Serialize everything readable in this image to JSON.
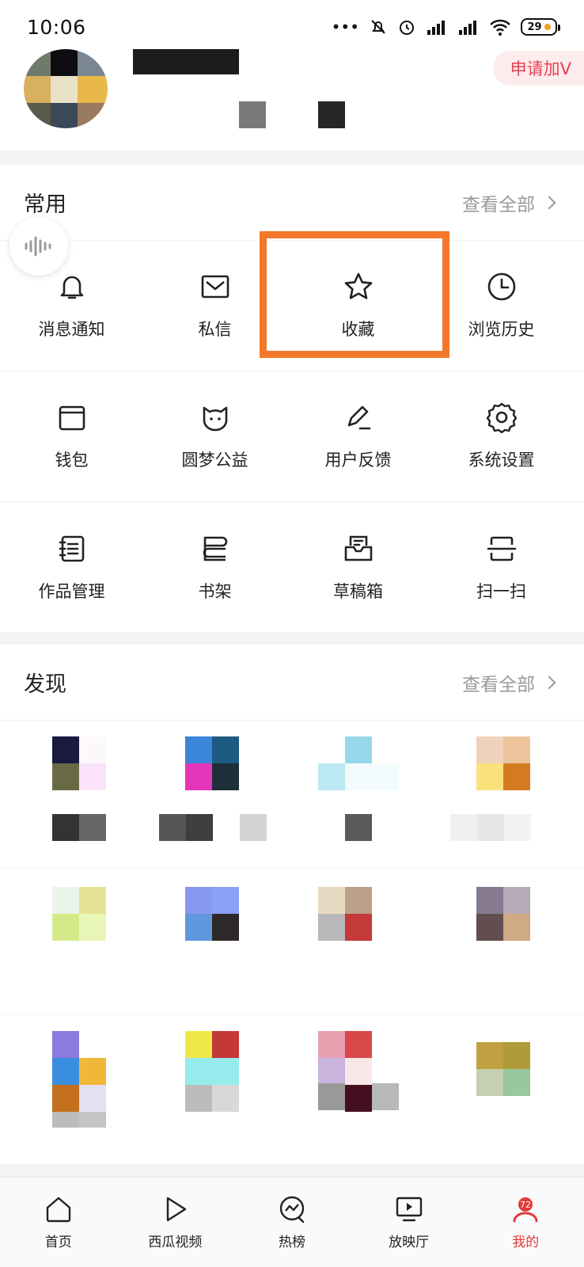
{
  "status_bar": {
    "time": "10:06",
    "battery": "29"
  },
  "profile": {
    "apply_v_label": "申请加V"
  },
  "common": {
    "title": "常用",
    "see_all": "查看全部",
    "items": [
      {
        "label": "消息通知",
        "icon": "bell-icon"
      },
      {
        "label": "私信",
        "icon": "mail-icon"
      },
      {
        "label": "收藏",
        "icon": "star-icon"
      },
      {
        "label": "浏览历史",
        "icon": "clock-icon"
      },
      {
        "label": "钱包",
        "icon": "wallet-icon"
      },
      {
        "label": "圆梦公益",
        "icon": "cat-face-icon"
      },
      {
        "label": "用户反馈",
        "icon": "pen-icon"
      },
      {
        "label": "系统设置",
        "icon": "gear-icon"
      },
      {
        "label": "作品管理",
        "icon": "notebook-icon"
      },
      {
        "label": "书架",
        "icon": "books-icon"
      },
      {
        "label": "草稿箱",
        "icon": "draft-box-icon"
      },
      {
        "label": "扫一扫",
        "icon": "scan-icon"
      }
    ]
  },
  "discover": {
    "title": "发现",
    "see_all": "查看全部"
  },
  "bottom_nav": {
    "items": [
      {
        "label": "首页",
        "icon": "home-icon"
      },
      {
        "label": "西瓜视频",
        "icon": "play-icon"
      },
      {
        "label": "热榜",
        "icon": "trend-icon"
      },
      {
        "label": "放映厅",
        "icon": "screen-icon"
      },
      {
        "label": "我的",
        "icon": "profile-icon"
      }
    ],
    "active": "我的",
    "badge": "72"
  },
  "colors": {
    "accent": "#e23a3a",
    "highlight_border": "#f4772b",
    "apply_v_bg": "#fdeced"
  }
}
